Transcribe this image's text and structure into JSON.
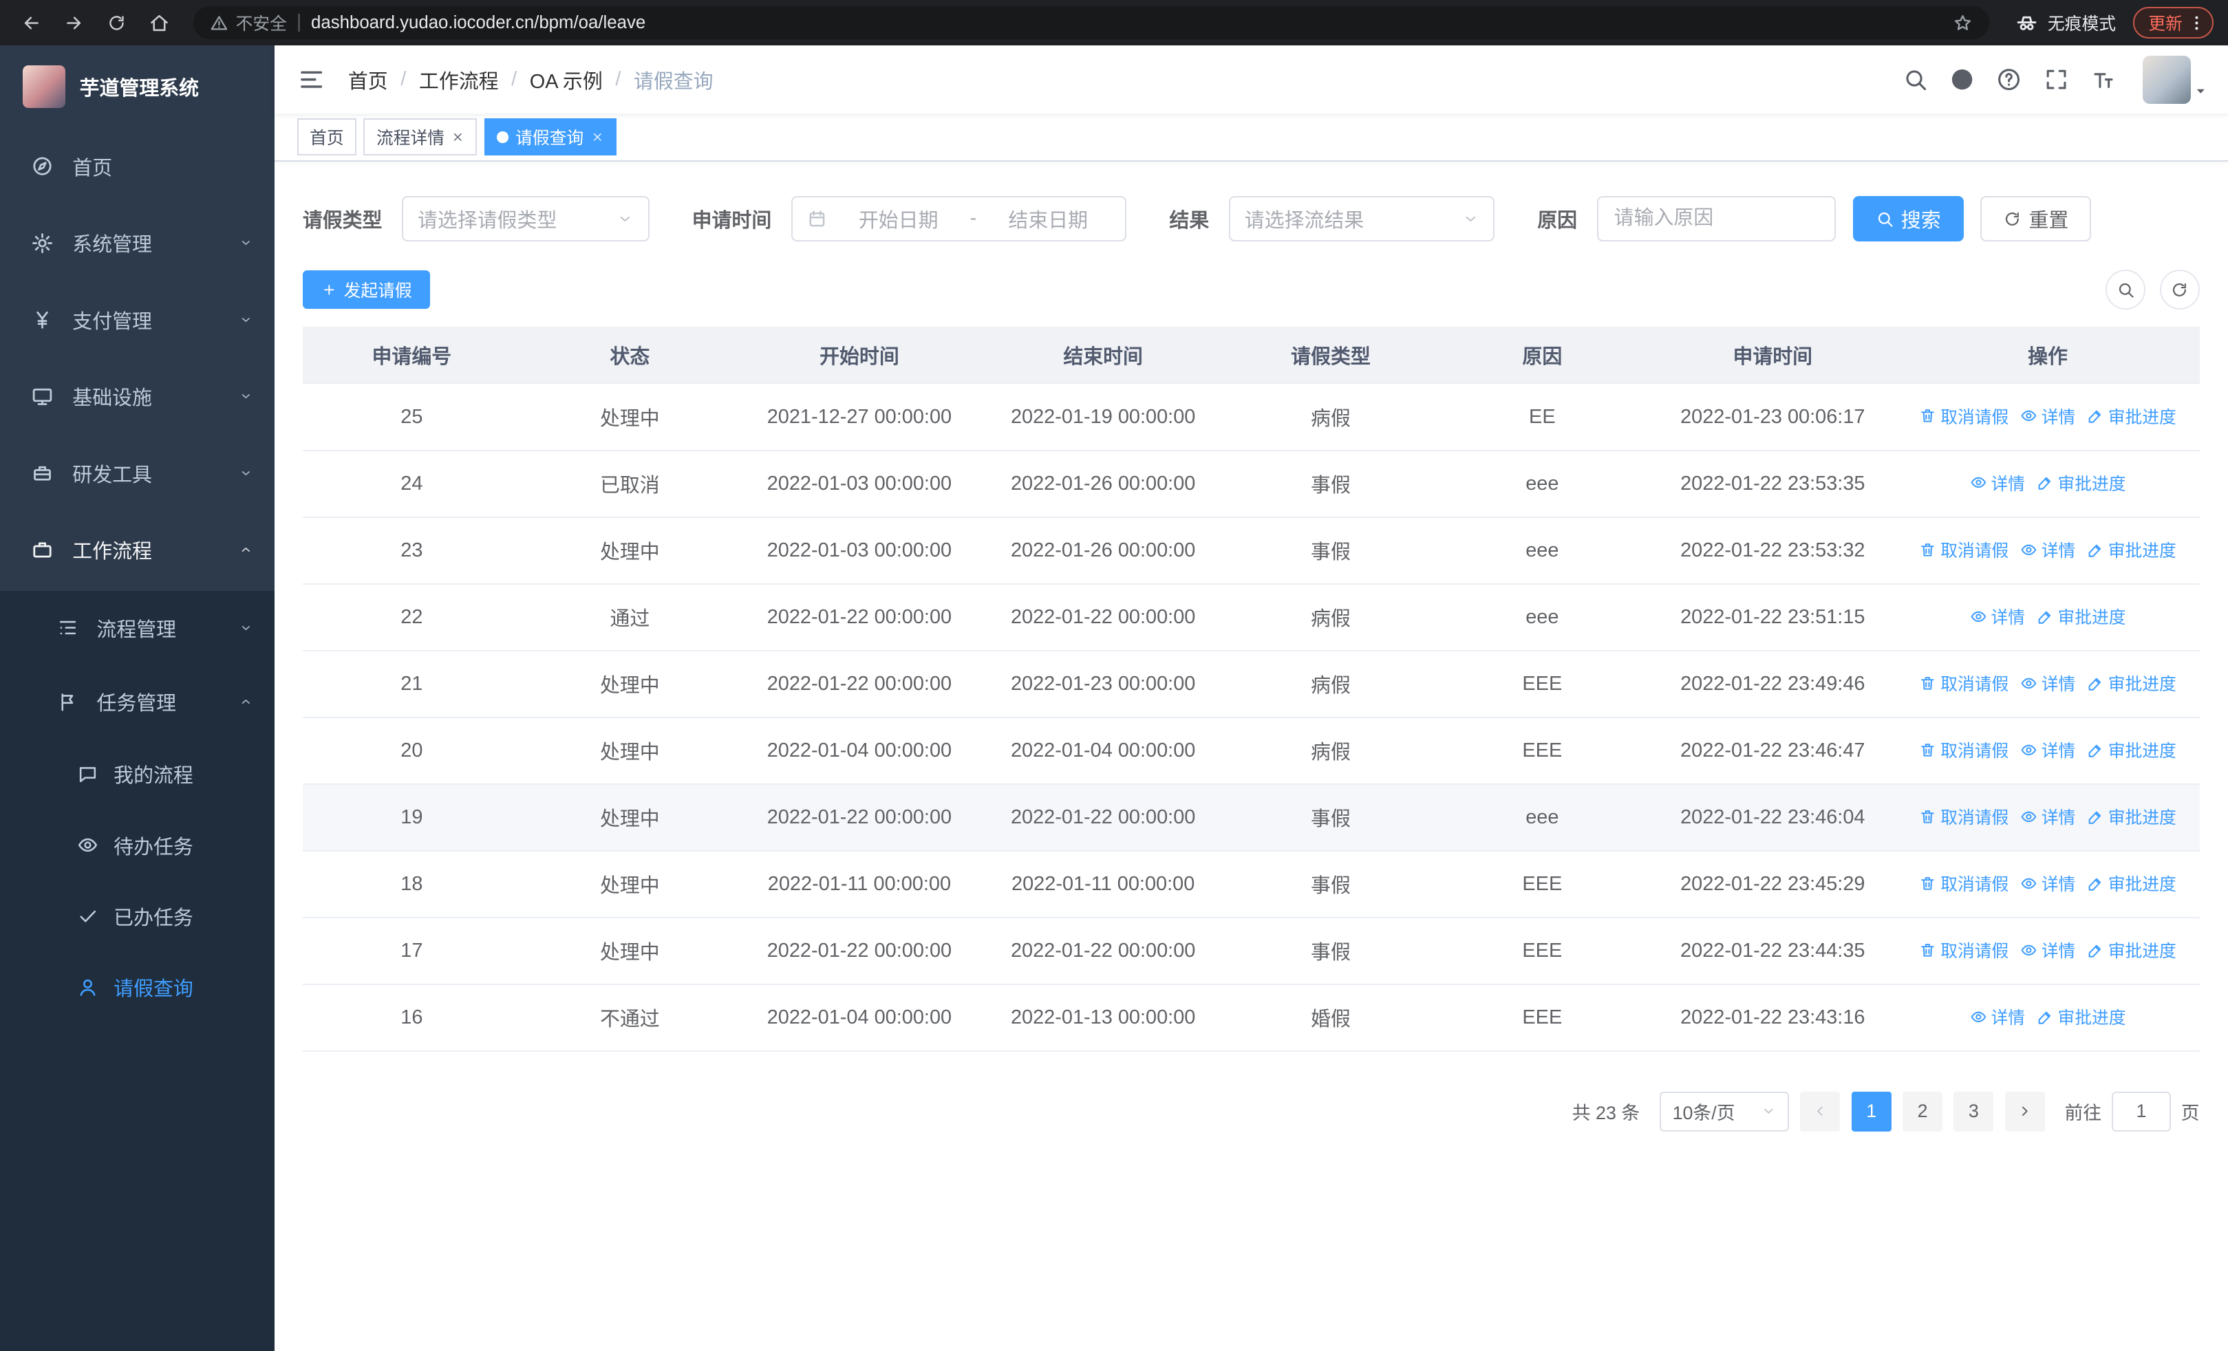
{
  "browser": {
    "security_label": "不安全",
    "url": "dashboard.yudao.iocoder.cn/bpm/oa/leave",
    "incognito_label": "无痕模式",
    "update_label": "更新"
  },
  "sidebar": {
    "title": "芋道管理系统",
    "items": [
      {
        "label": "首页"
      },
      {
        "label": "系统管理"
      },
      {
        "label": "支付管理"
      },
      {
        "label": "基础设施"
      },
      {
        "label": "研发工具"
      },
      {
        "label": "工作流程"
      }
    ],
    "process_items": [
      {
        "label": "流程管理"
      },
      {
        "label": "任务管理"
      }
    ],
    "task_items": [
      {
        "label": "我的流程"
      },
      {
        "label": "待办任务"
      },
      {
        "label": "已办任务"
      },
      {
        "label": "请假查询"
      }
    ]
  },
  "header": {
    "breadcrumb": [
      "首页",
      "工作流程",
      "OA 示例",
      "请假查询"
    ],
    "separator": "/"
  },
  "tabs": [
    {
      "label": "首页"
    },
    {
      "label": "流程详情"
    },
    {
      "label": "请假查询"
    }
  ],
  "filters": {
    "leave_type_label": "请假类型",
    "leave_type_placeholder": "请选择请假类型",
    "apply_time_label": "申请时间",
    "start_date_placeholder": "开始日期",
    "date_separator": "-",
    "end_date_placeholder": "结束日期",
    "result_label": "结果",
    "result_placeholder": "请选择流结果",
    "reason_label": "原因",
    "reason_placeholder": "请输入原因",
    "search_label": "搜索",
    "reset_label": "重置"
  },
  "toolbar": {
    "create_label": "发起请假"
  },
  "table": {
    "headers": [
      "申请编号",
      "状态",
      "开始时间",
      "结束时间",
      "请假类型",
      "原因",
      "申请时间",
      "操作"
    ],
    "actions": {
      "cancel": "取消请假",
      "detail": "详情",
      "progress": "审批进度"
    },
    "rows": [
      {
        "id": "25",
        "status": "处理中",
        "start": "2021-12-27 00:00:00",
        "end": "2022-01-19 00:00:00",
        "type": "病假",
        "reason": "EE",
        "apply_time": "2022-01-23 00:06:17",
        "can_cancel": true,
        "highlighted": false
      },
      {
        "id": "24",
        "status": "已取消",
        "start": "2022-01-03 00:00:00",
        "end": "2022-01-26 00:00:00",
        "type": "事假",
        "reason": "eee",
        "apply_time": "2022-01-22 23:53:35",
        "can_cancel": false,
        "highlighted": false
      },
      {
        "id": "23",
        "status": "处理中",
        "start": "2022-01-03 00:00:00",
        "end": "2022-01-26 00:00:00",
        "type": "事假",
        "reason": "eee",
        "apply_time": "2022-01-22 23:53:32",
        "can_cancel": true,
        "highlighted": false
      },
      {
        "id": "22",
        "status": "通过",
        "start": "2022-01-22 00:00:00",
        "end": "2022-01-22 00:00:00",
        "type": "病假",
        "reason": "eee",
        "apply_time": "2022-01-22 23:51:15",
        "can_cancel": false,
        "highlighted": false
      },
      {
        "id": "21",
        "status": "处理中",
        "start": "2022-01-22 00:00:00",
        "end": "2022-01-23 00:00:00",
        "type": "病假",
        "reason": "EEE",
        "apply_time": "2022-01-22 23:49:46",
        "can_cancel": true,
        "highlighted": false
      },
      {
        "id": "20",
        "status": "处理中",
        "start": "2022-01-04 00:00:00",
        "end": "2022-01-04 00:00:00",
        "type": "病假",
        "reason": "EEE",
        "apply_time": "2022-01-22 23:46:47",
        "can_cancel": true,
        "highlighted": false
      },
      {
        "id": "19",
        "status": "处理中",
        "start": "2022-01-22 00:00:00",
        "end": "2022-01-22 00:00:00",
        "type": "事假",
        "reason": "eee",
        "apply_time": "2022-01-22 23:46:04",
        "can_cancel": true,
        "highlighted": true
      },
      {
        "id": "18",
        "status": "处理中",
        "start": "2022-01-11 00:00:00",
        "end": "2022-01-11 00:00:00",
        "type": "事假",
        "reason": "EEE",
        "apply_time": "2022-01-22 23:45:29",
        "can_cancel": true,
        "highlighted": false
      },
      {
        "id": "17",
        "status": "处理中",
        "start": "2022-01-22 00:00:00",
        "end": "2022-01-22 00:00:00",
        "type": "事假",
        "reason": "EEE",
        "apply_time": "2022-01-22 23:44:35",
        "can_cancel": true,
        "highlighted": false
      },
      {
        "id": "16",
        "status": "不通过",
        "start": "2022-01-04 00:00:00",
        "end": "2022-01-13 00:00:00",
        "type": "婚假",
        "reason": "EEE",
        "apply_time": "2022-01-22 23:43:16",
        "can_cancel": false,
        "highlighted": false
      }
    ]
  },
  "pagination": {
    "total_label": "共 23 条",
    "page_size_label": "10条/页",
    "pages": [
      "1",
      "2",
      "3"
    ],
    "active_page": "1",
    "goto_label": "前往",
    "goto_value": "1",
    "page_unit_label": "页"
  },
  "colors": {
    "primary": "#409eff",
    "sidebar_bg": "#2d3a4b",
    "submenu_bg": "#1f2d3d",
    "chrome_bg": "#202124",
    "active_tab_bg": "#409eff",
    "update_chip_text": "#ff6d5e"
  }
}
